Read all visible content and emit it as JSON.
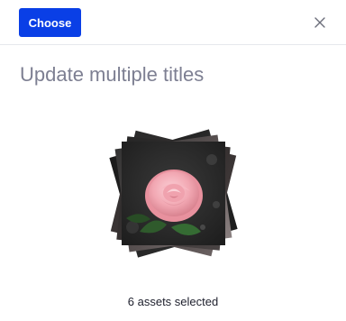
{
  "header": {
    "choose_label": "Choose",
    "close_icon": "close-icon"
  },
  "title": "Update multiple titles",
  "preview": {
    "image_subject": "pink rose photo"
  },
  "selection": {
    "count_text": "6 assets selected"
  },
  "colors": {
    "primary": "#0a3fe6",
    "title": "#7d7f92",
    "text": "#1d1f2c",
    "divider": "#e6e8ec"
  }
}
